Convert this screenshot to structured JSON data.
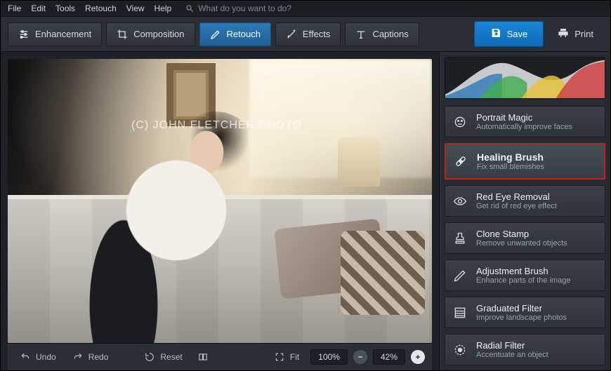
{
  "menu": {
    "items": [
      "File",
      "Edit",
      "Tools",
      "Retouch",
      "View",
      "Help"
    ]
  },
  "search": {
    "placeholder": "What do you want to do?"
  },
  "tabs": {
    "enhancement": "Enhancement",
    "composition": "Composition",
    "retouch": "Retouch",
    "effects": "Effects",
    "captions": "Captions"
  },
  "actions": {
    "save": "Save",
    "print": "Print"
  },
  "watermark": "(C) JOHN FLETCHER PHOTO",
  "panel": {
    "portrait_magic": {
      "title": "Portrait Magic",
      "sub": "Automatically improve faces"
    },
    "healing_brush": {
      "title": "Healing Brush",
      "sub": "Fix small blemishes"
    },
    "red_eye": {
      "title": "Red Eye Removal",
      "sub": "Get rid of red eye effect"
    },
    "clone_stamp": {
      "title": "Clone Stamp",
      "sub": "Remove unwanted objects"
    },
    "adjustment_brush": {
      "title": "Adjustment Brush",
      "sub": "Enhance parts of the image"
    },
    "graduated_filter": {
      "title": "Graduated Filter",
      "sub": "Improve landscape photos"
    },
    "radial_filter": {
      "title": "Radial Filter",
      "sub": "Accentuate an object"
    }
  },
  "status": {
    "undo": "Undo",
    "redo": "Redo",
    "reset": "Reset",
    "fit": "Fit",
    "zoom_full": "100%",
    "zoom_current": "42%"
  }
}
